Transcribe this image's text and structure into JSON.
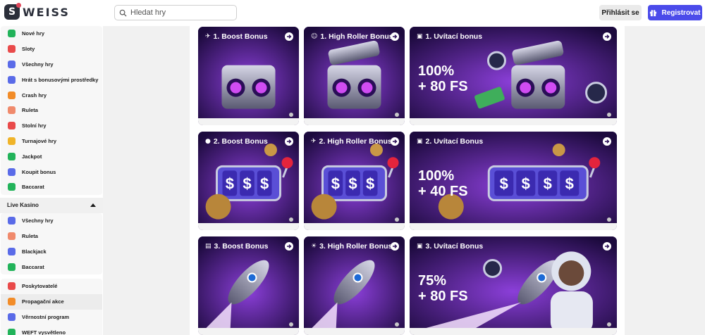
{
  "header": {
    "logo_text": "WEISS",
    "search_placeholder": "Hledat hry",
    "login_label": "Přihlásit se",
    "register_label": "Registrovat"
  },
  "sidebar": {
    "items": [
      {
        "label": "Nové hry",
        "icon": "new-games-icon",
        "color": "#22b35a"
      },
      {
        "label": "Sloty",
        "icon": "slots-icon",
        "color": "#e94a4a"
      },
      {
        "label": "Všechny hry",
        "icon": "all-games-icon",
        "color": "#5a6be8"
      },
      {
        "label": "Hrát s bonusovými prostředky",
        "icon": "bonus-funds-icon",
        "color": "#5a6be8"
      },
      {
        "label": "Crash hry",
        "icon": "rocket-icon",
        "color": "#f28c28"
      },
      {
        "label": "Ruleta",
        "icon": "roulette-icon",
        "color": "#f08a6c"
      },
      {
        "label": "Stolní hry",
        "icon": "table-games-icon",
        "color": "#e94a4a"
      },
      {
        "label": "Turnajové hry",
        "icon": "trophy-icon",
        "color": "#f0b429"
      },
      {
        "label": "Jackpot",
        "icon": "jackpot-icon",
        "color": "#22b35a"
      },
      {
        "label": "Koupit bonus",
        "icon": "buy-bonus-icon",
        "color": "#5a6be8"
      },
      {
        "label": "Baccarat",
        "icon": "baccarat-icon",
        "color": "#22b35a"
      }
    ],
    "live_section": {
      "title": "Live Kasino",
      "items": [
        {
          "label": "Všechny hry",
          "icon": "all-games-icon",
          "color": "#5a6be8"
        },
        {
          "label": "Ruleta",
          "icon": "roulette-icon",
          "color": "#f08a6c"
        },
        {
          "label": "Blackjack",
          "icon": "blackjack-icon",
          "color": "#5a6be8"
        },
        {
          "label": "Baccarat",
          "icon": "baccarat-icon",
          "color": "#22b35a"
        }
      ]
    },
    "bottom_items": [
      {
        "label": "Poskytovatelé",
        "icon": "providers-icon",
        "color": "#e94a4a"
      },
      {
        "label": "Propagační akce",
        "icon": "promotions-icon",
        "color": "#f28c28"
      },
      {
        "label": "Věrnostní program",
        "icon": "loyalty-icon",
        "color": "#5a6be8"
      },
      {
        "label": "WEFT vysvětleno",
        "icon": "weft-icon",
        "color": "#22b35a"
      }
    ]
  },
  "promos": [
    {
      "title": "1. Boost Bonus",
      "emoji": "✈",
      "art": "chest"
    },
    {
      "title": "1. High Roller Bonus",
      "emoji": "☺",
      "art": "chest-open"
    },
    {
      "title": "1. Uvítací bonus",
      "emoji": "▣",
      "art": "chest-money",
      "promo": [
        "100%",
        "+ 80 FS"
      ]
    },
    {
      "title": "2. Boost Bonus",
      "emoji": "●",
      "art": "slot"
    },
    {
      "title": "2. High Roller Bonus",
      "emoji": "✈",
      "art": "slot-money"
    },
    {
      "title": "2. Uvítací Bonus",
      "emoji": "▣",
      "art": "slot-wide",
      "promo": [
        "100%",
        "+ 40 FS"
      ]
    },
    {
      "title": "3. Boost Bonus",
      "emoji": "▤",
      "art": "rocket"
    },
    {
      "title": "3. High Roller Bonus",
      "emoji": "☀",
      "art": "rocket2"
    },
    {
      "title": "3. Uvítací Bonus",
      "emoji": "▣",
      "art": "astronaut",
      "promo": [
        "75%",
        "+ 80 FS"
      ]
    }
  ],
  "colors": {
    "accent": "#4b4bea",
    "card_bg": "#2a0e57",
    "card_glow": "#8b3fd9"
  }
}
